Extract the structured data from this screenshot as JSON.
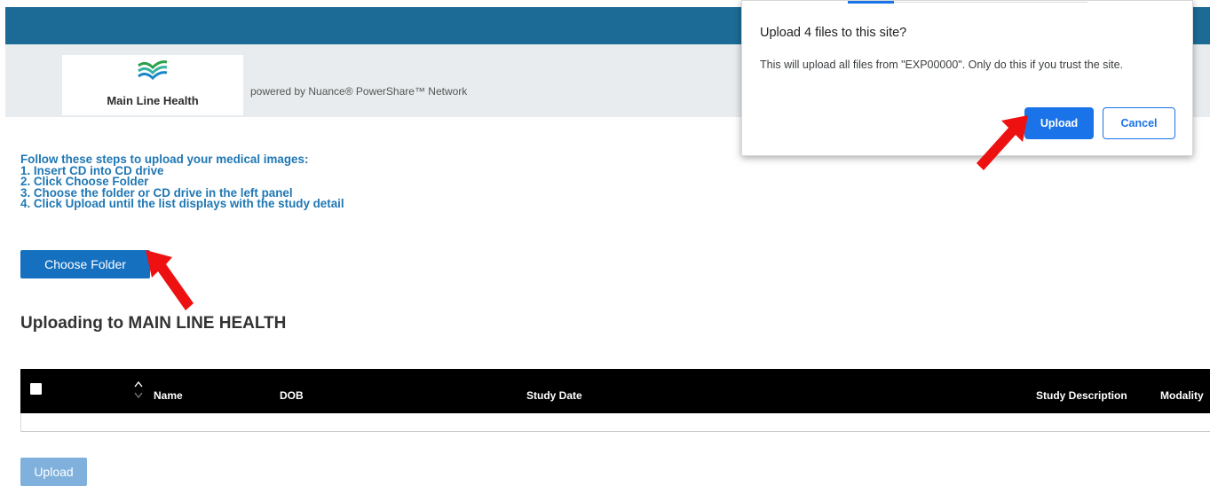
{
  "header": {
    "logo_text": "Main Line Health",
    "powered_by": "powered by Nuance® PowerShare™ Network"
  },
  "instructions": {
    "heading": "Follow these steps to upload your medical images:",
    "steps": [
      "1. Insert CD into CD drive",
      "2. Click Choose Folder",
      "3. Choose the folder or CD drive in the left panel",
      "4. Click Upload until the list displays with the study detail"
    ]
  },
  "choose_folder_label": "Choose Folder",
  "upload_title": "Uploading to MAIN LINE HEALTH",
  "table": {
    "columns": [
      "Name",
      "DOB",
      "Study Date",
      "Study Description",
      "Modality"
    ]
  },
  "upload_label": "Upload",
  "dialog": {
    "title": "Upload 4 files to this site?",
    "message": "This will upload all files from \"EXP00000\". Only do this if you trust the site.",
    "upload_label": "Upload",
    "cancel_label": "Cancel"
  },
  "colors": {
    "topbar": "#1c6b96",
    "accent": "#1570c0",
    "dialog_accent": "#1a73e8",
    "annotation_arrow": "#ee1111"
  }
}
